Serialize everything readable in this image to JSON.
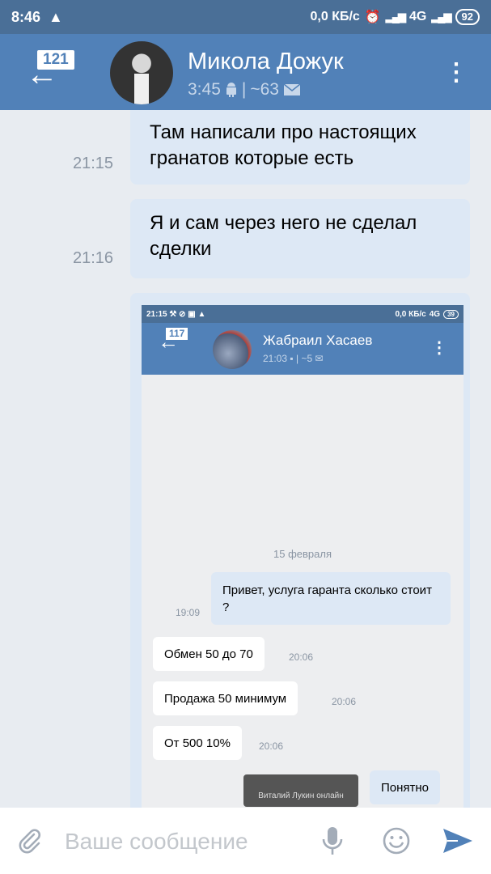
{
  "status_bar": {
    "time": "8:46",
    "speed": "0,0 КБ/с",
    "network": "4G",
    "battery": "92"
  },
  "header": {
    "unread_count": "121",
    "contact_name": "Микола Дожук",
    "last_seen": "3:45",
    "separator": "|",
    "mail_count": "~63"
  },
  "messages": [
    {
      "text": "Там написали про настоящих гранатов которые есть",
      "time": "21:15"
    },
    {
      "text": "Я и сам через него не сделал сделки",
      "time": "21:16"
    }
  ],
  "embedded_screenshot": {
    "status_time": "21:15",
    "status_speed": "0,0 КБ/с",
    "status_network": "4G",
    "status_battery": "39",
    "unread_count": "117",
    "contact_name": "Жабраил Хасаев",
    "last_seen": "21:03",
    "separator": "|",
    "mail_count": "~5",
    "date_label": "15 февраля",
    "messages": [
      {
        "text": "Привет, услуга гаранта сколько стоит ?",
        "time": "19:09"
      },
      {
        "text": "Обмен 50 до 70",
        "time": "20:06"
      },
      {
        "text": "Продажа 50 минимум",
        "time": "20:06"
      },
      {
        "text": "От 500 10%",
        "time": "20:06"
      },
      {
        "text": "Понятно",
        "time": ""
      }
    ],
    "toast": "Виталий Лукин онлайн"
  },
  "input": {
    "placeholder": "Ваше сообщение"
  },
  "colors": {
    "header": "#5181b8",
    "status_bar": "#4a6f97",
    "bubble_out": "#dde8f5",
    "chat_bg": "#e8ecf1"
  },
  "icons": [
    "warning-icon",
    "alarm-icon",
    "back-arrow-icon",
    "android-icon",
    "mail-icon",
    "more-vert-icon",
    "attach-icon",
    "mic-icon",
    "emoji-icon",
    "send-icon"
  ]
}
